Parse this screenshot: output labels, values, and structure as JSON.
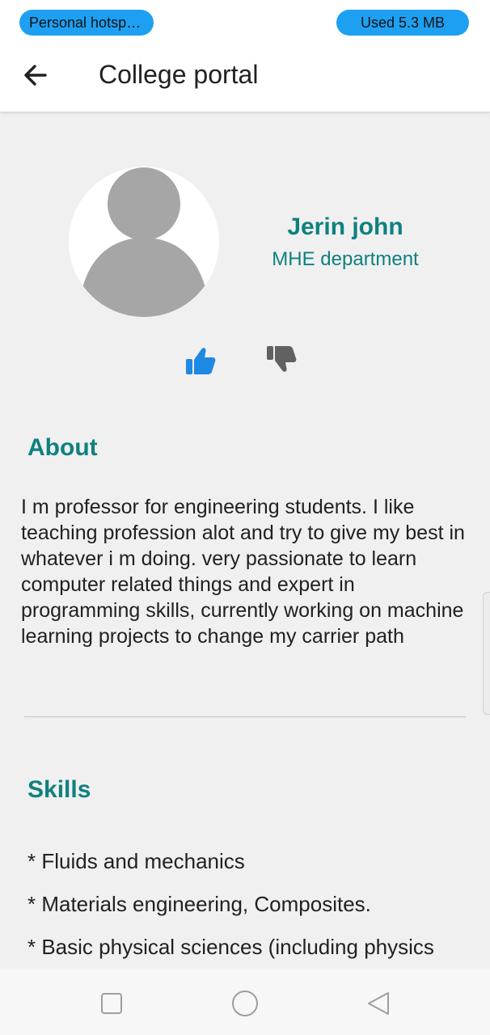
{
  "status_bar": {
    "hotspot_label": "Personal hotspot…",
    "data_used_label": "Used  5.3 MB",
    "pill_color": "#1ea0f2"
  },
  "app_bar": {
    "back_icon": "arrow-left-icon",
    "title": "College portal"
  },
  "profile": {
    "avatar_icon": "person-placeholder-icon",
    "name": "Jerin john",
    "department": "MHE department",
    "like_icon": "thumbs-up-icon",
    "dislike_icon": "thumbs-down-icon",
    "accent_color": "#0f8080"
  },
  "about": {
    "title": "About",
    "text": "I m professor for engineering students. I like teaching profession alot and try to give my best in whatever i m doing. very passionate to learn computer related things and expert in programming skills, currently working on machine learning projects to change my carrier path"
  },
  "skills": {
    "title": "Skills",
    "items": [
      "* Fluids and mechanics",
      "* Materials engineering, Composites.",
      "* Basic physical sciences (including physics"
    ]
  },
  "nav_bar": {
    "recent_icon": "square-icon",
    "home_icon": "circle-icon",
    "back_icon": "triangle-back-icon"
  }
}
